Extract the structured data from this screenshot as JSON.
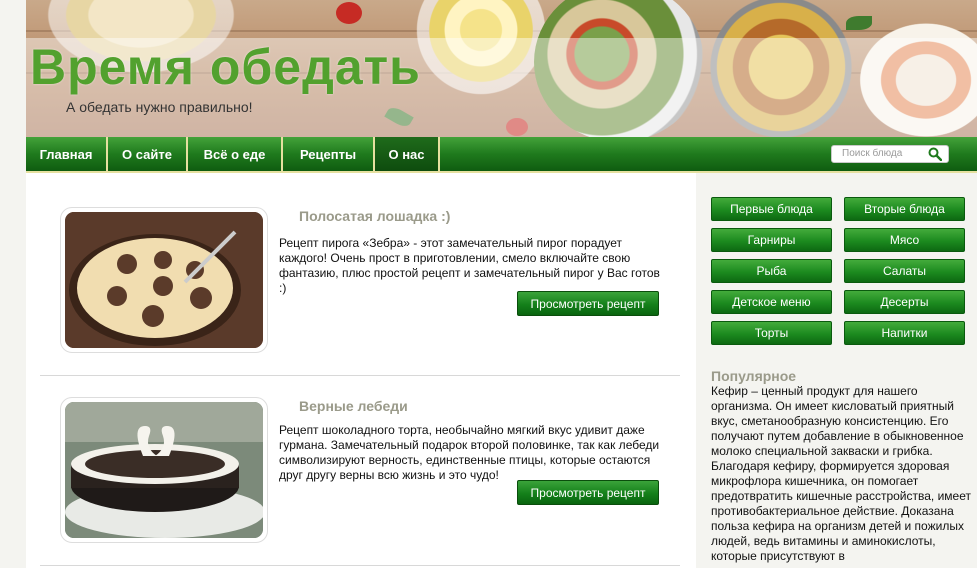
{
  "header": {
    "title": "Время обедать",
    "tagline": "А обедать нужно правильно!"
  },
  "nav": {
    "items": [
      {
        "label": "Главная"
      },
      {
        "label": "О сайте"
      },
      {
        "label": "Всё о еде"
      },
      {
        "label": "Рецепты"
      },
      {
        "label": "О нас",
        "active": true
      }
    ],
    "search_placeholder": "Поиск блюда"
  },
  "posts": [
    {
      "title": "Полосатая лошадка :)",
      "text": "Рецепт пирога «Зебра» - этот замечательный пирог порадует каждого! Очень прост в приготовлении, смело включайте свою фантазию, плюс простой рецепт и замечательный пирог у Вас готов :)",
      "button": "Просмотреть рецепт"
    },
    {
      "title": "Верные лебеди",
      "text": "Рецепт шоколадного торта, необычайно мягкий вкус удивит даже гурмана. Замечательный подарок второй половинке, так как лебеди символизируют верность, единственные птицы, которые остаются друг другу верны всю жизнь и это чудо!",
      "button": "Просмотреть рецепт"
    }
  ],
  "sidebar": {
    "categories": [
      "Первые блюда",
      "Вторые блюда",
      "Гарниры",
      "Мясо",
      "Рыба",
      "Салаты",
      "Детское меню",
      "Десерты",
      "Торты",
      "Напитки"
    ],
    "popular_title": "Популярное",
    "popular_text": "Кефир – ценный продукт для нашего организма. Он имеет кисловатый приятный вкус, сметанообразную консистенцию. Его получают путем добавление в обыкновенное молоко специальной закваски и грибка. Благодаря кефиру, формируется здоровая микрофлора кишечника, он помогает предотвратить кишечные расстройства, имеет противобактериальное действие. Доказана польза кефира на организм детей и пожилых людей, ведь витамины и аминокислоты, которые присутствуют в"
  },
  "colors": {
    "accent_green": "#1c8a1f",
    "title_green": "#52a12e",
    "muted_heading": "#9a9a8a"
  }
}
